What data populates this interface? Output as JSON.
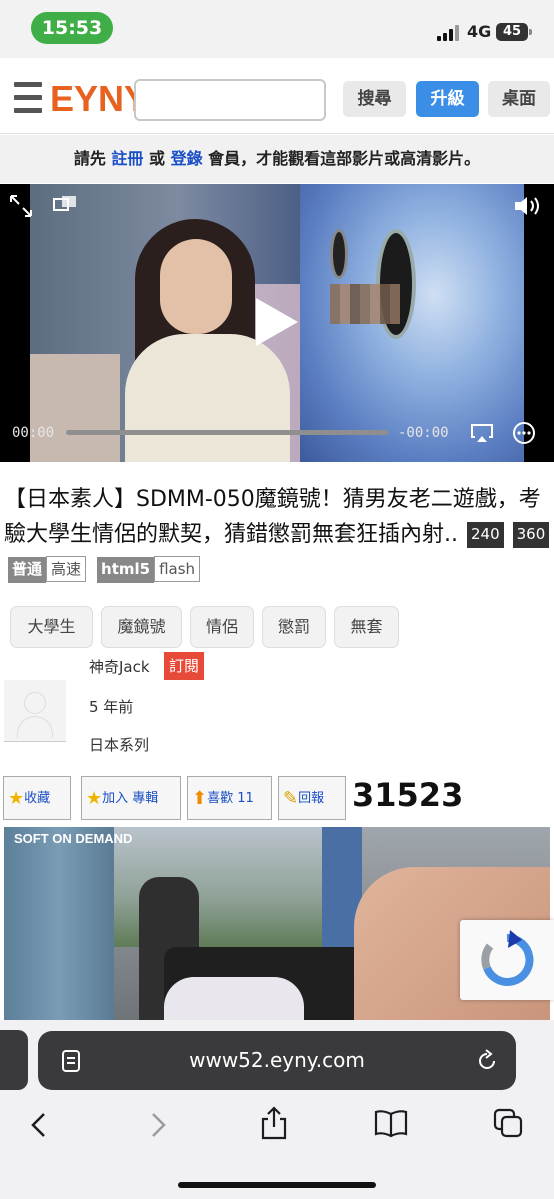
{
  "status_bar": {
    "time": "15:53",
    "network": "4G",
    "battery": "45"
  },
  "header": {
    "logo": "EYNY",
    "search_placeholder": "",
    "search_label": "搜尋",
    "upgrade_label": "升級",
    "desktop_label": "桌面"
  },
  "notice": {
    "pre": "請先 ",
    "register": "註冊",
    "or": " 或 ",
    "login": "登錄",
    "post": " 會員，才能觀看這部影片或高清影片。"
  },
  "video": {
    "current_time": "00:00",
    "remaining_time": "-00:00"
  },
  "title": {
    "text": "【日本素人】SDMM-050魔鏡號！猜男友老二遊戲，考驗大學生情侶的默契，猜錯懲罰無套狂插內射..",
    "badges": [
      "240",
      "360"
    ],
    "quality": [
      "普通",
      "高速"
    ],
    "format": [
      "html5",
      "flash"
    ]
  },
  "tags": [
    "大學生",
    "魔鏡號",
    "情侶",
    "懲罰",
    "無套"
  ],
  "uploader": {
    "name": "神奇Jack",
    "subscribe_label": "訂閱",
    "posted": "5 年前",
    "category": "日本系列"
  },
  "actions": {
    "favorite": "收藏",
    "add_album": "加入 專輯",
    "like": "喜歡 11",
    "report": "回報",
    "views": "31523"
  },
  "preview": {
    "brand": "SOFT ON DEMAND"
  },
  "browser": {
    "url": "www52.eyny.com"
  },
  "colors": {
    "accent_orange": "#e8621f",
    "link_blue": "#1a4fc6",
    "upgrade_blue": "#3a8ee6",
    "subscribe_red": "#e84a3a",
    "status_green": "#3fae47"
  }
}
